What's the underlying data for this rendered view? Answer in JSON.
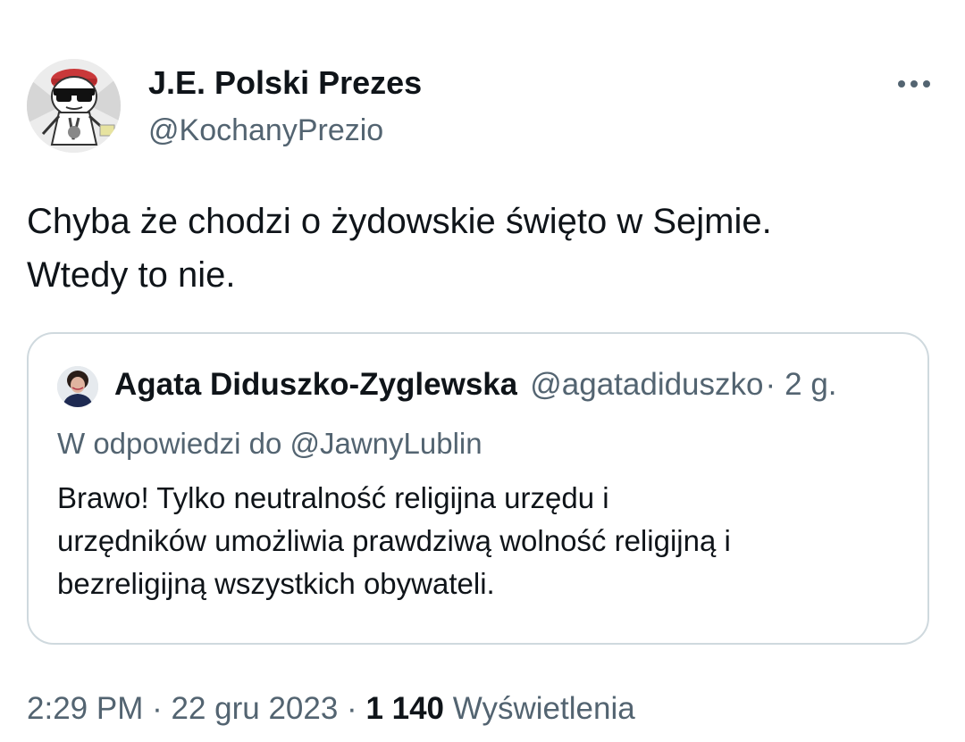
{
  "tweet": {
    "author": {
      "display_name": "J.E. Polski Prezes",
      "handle": "@KochanyPrezio",
      "avatar_icon": "cartoon-avatar-with-sunglasses"
    },
    "more_icon": "more-horizontal-icon",
    "text_lines": [
      "Chyba że chodzi o żydowskie święto w Sejmie.",
      "Wtedy to nie."
    ],
    "quote": {
      "author_name": "Agata Diduszko-Zyglewska",
      "author_handle": "@agatadiduszko",
      "separator": "·",
      "time_ago": "2 g.",
      "reply_prefix": "W odpowiedzi do",
      "reply_to": "@JawnyLublin",
      "text_lines": [
        "Brawo! Tylko neutralność religijna urzędu i",
        "urzędników umożliwia prawdziwą wolność religijną i",
        "bezreligijną wszystkich obywateli."
      ]
    },
    "meta": {
      "time": "2:29 PM",
      "separator": "·",
      "date": "22 gru 2023",
      "views_count": "1 140",
      "views_label": "Wyświetlenia"
    }
  }
}
